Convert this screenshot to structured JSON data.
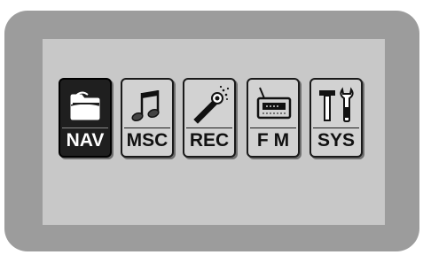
{
  "menu": {
    "items": [
      {
        "label": "NAV",
        "icon": "folder-icon",
        "selected": true
      },
      {
        "label": "MSC",
        "icon": "music-note-icon",
        "selected": false
      },
      {
        "label": "REC",
        "icon": "microphone-icon",
        "selected": false
      },
      {
        "label": "F M",
        "icon": "radio-icon",
        "selected": false
      },
      {
        "label": "SYS",
        "icon": "tools-icon",
        "selected": false
      }
    ]
  },
  "colors": {
    "bezel": "#9c9c9c",
    "screen": "#c8c8c8",
    "selected_tile": "#1f1f1f",
    "tile": "#d2d2d2"
  }
}
